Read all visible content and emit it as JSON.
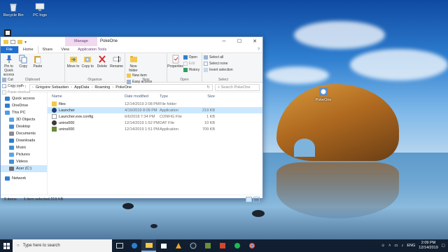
{
  "desktop": {
    "icons": [
      {
        "label": "Recycle Bin",
        "icon": "recycle-bin-icon"
      },
      {
        "label": "PC Ingo",
        "icon": "pc-icon"
      },
      {
        "label": "PokeOne",
        "icon": "app-shortcut-icon"
      }
    ],
    "tooltip_label": "PokeOne"
  },
  "window": {
    "manage_label": "Manage",
    "title": "PokeOne",
    "tabs": [
      "File",
      "Home",
      "Share",
      "View",
      "Application Tools"
    ],
    "ribbon": {
      "clipboard": {
        "pin_label": "Pin to Quick access",
        "copy_label": "Copy",
        "paste_label": "Paste",
        "cut_label": "Cut",
        "copy_path_label": "Copy path",
        "paste_shortcut_label": "Paste shortcut",
        "group_label": "Clipboard"
      },
      "organize": {
        "move_to_label": "Move to",
        "copy_to_label": "Copy to",
        "delete_label": "Delete",
        "rename_label": "Rename",
        "group_label": "Organize"
      },
      "new": {
        "new_folder_label": "New folder",
        "new_item_label": "New item",
        "easy_access_label": "Easy access",
        "group_label": "New"
      },
      "open": {
        "properties_label": "Properties",
        "open_label": "Open",
        "edit_label": "Edit",
        "history_label": "History",
        "group_label": "Open"
      },
      "select": {
        "select_all_label": "Select all",
        "select_none_label": "Select none",
        "invert_label": "Invert selection",
        "group_label": "Select"
      }
    },
    "address": {
      "crumbs": [
        "Grégoire Sebastien",
        "AppData",
        "Roaming",
        "PokeOne"
      ],
      "search_placeholder": "Search PokeOne"
    },
    "navpane": [
      {
        "label": "Quick access",
        "icon": "star-icon",
        "color": "#2f7fd0"
      },
      {
        "label": "OneDrive",
        "icon": "cloud-icon",
        "color": "#2f7fd0"
      },
      {
        "label": "This PC",
        "icon": "pc-icon",
        "color": "#4a9ee6"
      },
      {
        "label": "3D Objects",
        "icon": "cube-icon",
        "color": "#58a6e8"
      },
      {
        "label": "Desktop",
        "icon": "desktop-icon",
        "color": "#3f8fd8"
      },
      {
        "label": "Documents",
        "icon": "documents-icon",
        "color": "#8b8b8b"
      },
      {
        "label": "Downloads",
        "icon": "download-icon",
        "color": "#2f7fd0"
      },
      {
        "label": "Music",
        "icon": "music-icon",
        "color": "#3f8fd8"
      },
      {
        "label": "Pictures",
        "icon": "pictures-icon",
        "color": "#58a6e8"
      },
      {
        "label": "Videos",
        "icon": "videos-icon",
        "color": "#3f8fd8"
      },
      {
        "label": "Acer (C:)",
        "icon": "drive-icon",
        "color": "#6d6d6d"
      },
      {
        "label": "Network",
        "icon": "network-icon",
        "color": "#2f7fd0"
      }
    ],
    "columns": {
      "name": "Name",
      "date": "Date modified",
      "type": "Type",
      "size": "Size"
    },
    "files": [
      {
        "name": "files",
        "date": "12/14/2019 2:08 PM",
        "type": "File folder",
        "size": "",
        "icon": "folder-icon"
      },
      {
        "name": "Launcher",
        "date": "4/19/2019 8:09 PM",
        "type": "Application",
        "size": "219 KB",
        "icon": "launcher-app-icon"
      },
      {
        "name": "Launcher.exe.config",
        "date": "6/6/2018 7:34 PM",
        "type": "CONFIG File",
        "size": "1 KB",
        "icon": "config-file-icon"
      },
      {
        "name": "unins000",
        "date": "12/14/2019 1:52 PM",
        "type": "DAT File",
        "size": "10 KB",
        "icon": "dat-file-icon"
      },
      {
        "name": "unins000",
        "date": "12/14/2019 1:51 PM",
        "type": "Application",
        "size": "709 KB",
        "icon": "uninstall-app-icon"
      }
    ],
    "status": {
      "items": "5 items",
      "selected": "1 item selected  219 KB"
    }
  },
  "taskbar": {
    "search_placeholder": "Type here to search",
    "apps": [
      "task-view-icon",
      "edge-icon",
      "file-explorer-icon",
      "store-icon",
      "winamp-icon",
      "steam-icon",
      "minecraft-icon",
      "red-app-icon",
      "spotify-icon",
      "chrome-icon"
    ],
    "lang": "ENG",
    "time": "2:09 PM",
    "date": "12/14/2019"
  },
  "colors": {
    "accent": "#1f6fd0",
    "selection": "#cce8ff",
    "manage": "#f1d9ef"
  }
}
